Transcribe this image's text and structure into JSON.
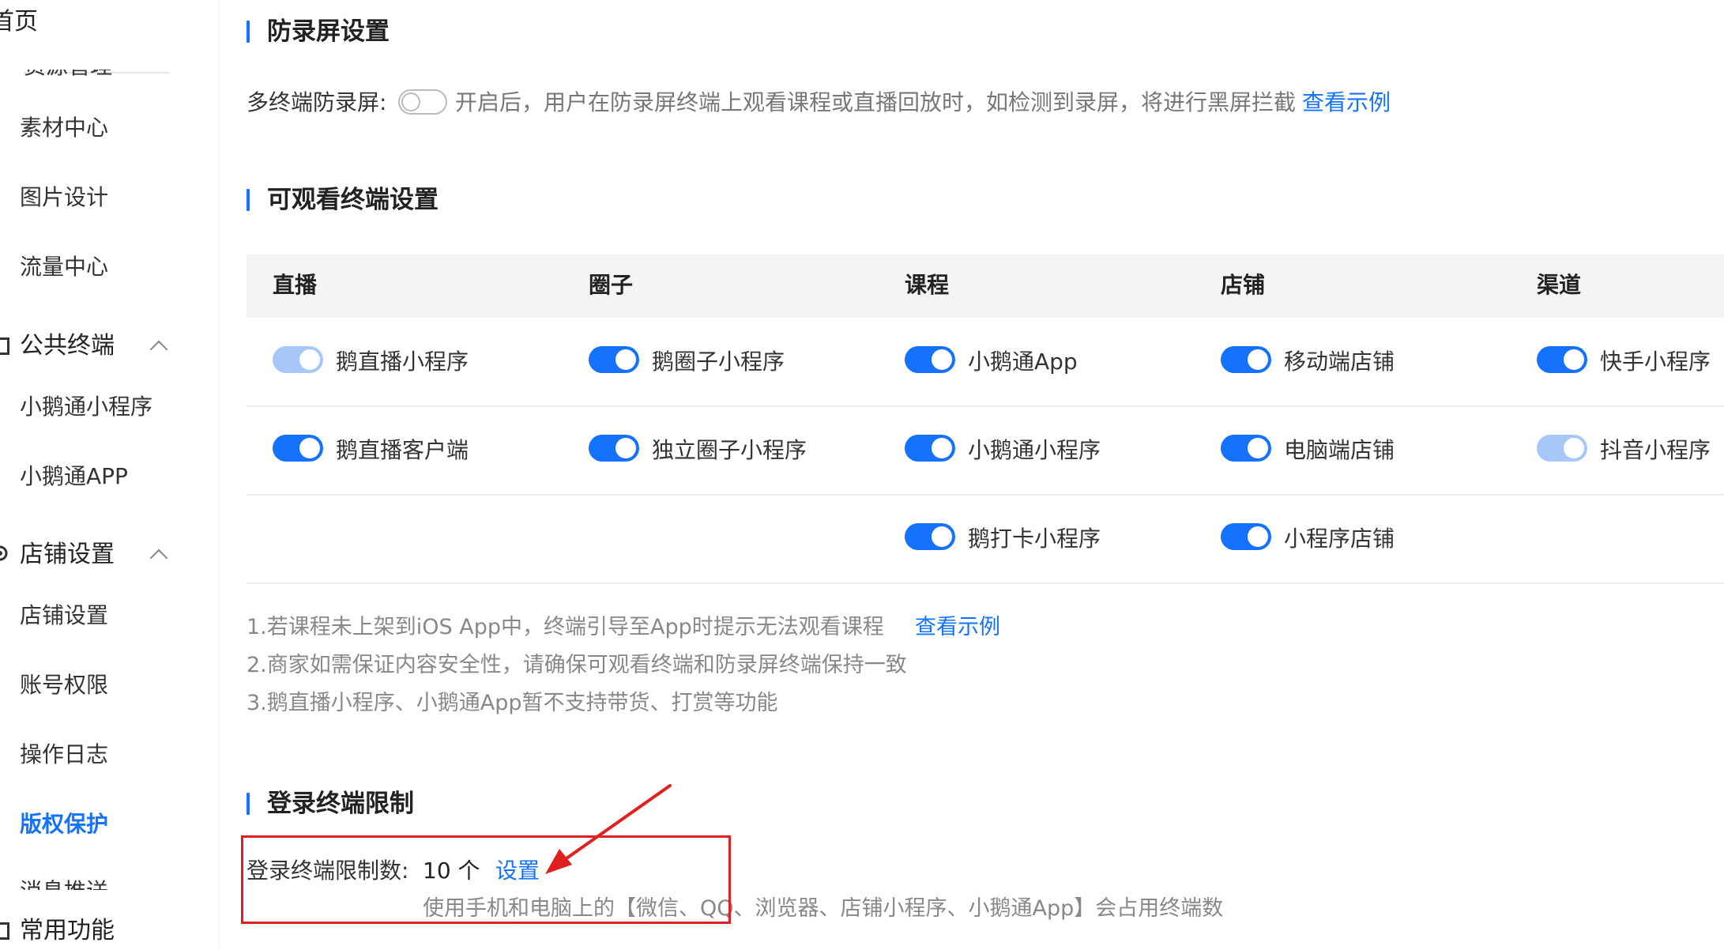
{
  "sidebar": {
    "home": "首页",
    "resource_mgmt": "资源管理",
    "material_center": "素材中心",
    "image_design": "图片设计",
    "traffic_center": "流量中心",
    "public_terminal": "公共终端",
    "xiaoe_miniprogram": "小鹅通小程序",
    "xiaoe_app": "小鹅通APP",
    "shop_settings_group": "店铺设置",
    "shop_settings": "店铺设置",
    "account_permissions": "账号权限",
    "operation_log": "操作日志",
    "copyright_protection": "版权保护",
    "message_push": "消息推送",
    "common_functions": "常用功能"
  },
  "anti_record": {
    "title": "防录屏设置",
    "label": "多终端防录屏:",
    "toggle_on": false,
    "description": "开启后，用户在防录屏终端上观看课程或直播回放时，如检测到录屏，将进行黑屏拦截",
    "example_link": "查看示例"
  },
  "viewable": {
    "title": "可观看终端设置",
    "columns": [
      {
        "header": "直播",
        "items": [
          {
            "label": "鹅直播小程序",
            "on": true,
            "disabled": true
          },
          {
            "label": "鹅直播客户端",
            "on": true,
            "disabled": false
          }
        ]
      },
      {
        "header": "圈子",
        "items": [
          {
            "label": "鹅圈子小程序",
            "on": true,
            "disabled": false
          },
          {
            "label": "独立圈子小程序",
            "on": true,
            "disabled": false
          }
        ]
      },
      {
        "header": "课程",
        "items": [
          {
            "label": "小鹅通App",
            "on": true,
            "disabled": false
          },
          {
            "label": "小鹅通小程序",
            "on": true,
            "disabled": false
          },
          {
            "label": "鹅打卡小程序",
            "on": true,
            "disabled": false
          }
        ]
      },
      {
        "header": "店铺",
        "items": [
          {
            "label": "移动端店铺",
            "on": true,
            "disabled": false
          },
          {
            "label": "电脑端店铺",
            "on": true,
            "disabled": false
          },
          {
            "label": "小程序店铺",
            "on": true,
            "disabled": false
          }
        ]
      },
      {
        "header": "渠道",
        "items": [
          {
            "label": "快手小程序",
            "on": true,
            "disabled": false
          },
          {
            "label": "抖音小程序",
            "on": true,
            "disabled": true
          }
        ]
      }
    ],
    "notes": [
      "1.若课程未上架到iOS App中，终端引导至App时提示无法观看课程",
      "2.商家如需保证内容安全性，请确保可观看终端和防录屏终端保持一致",
      "3.鹅直播小程序、小鹅通App暂不支持带货、打赏等功能"
    ],
    "note1_link": "查看示例"
  },
  "login_limit": {
    "title": "登录终端限制",
    "label": "登录终端限制数:",
    "value": "10 个",
    "set_link": "设置",
    "description": "使用手机和电脑上的【微信、QQ、浏览器、店铺小程序、小鹅通App】会占用终端数"
  },
  "colors": {
    "accent": "#1472ff",
    "toggle_disabled": "#a6c8f8",
    "annotation_red": "#e02020"
  }
}
